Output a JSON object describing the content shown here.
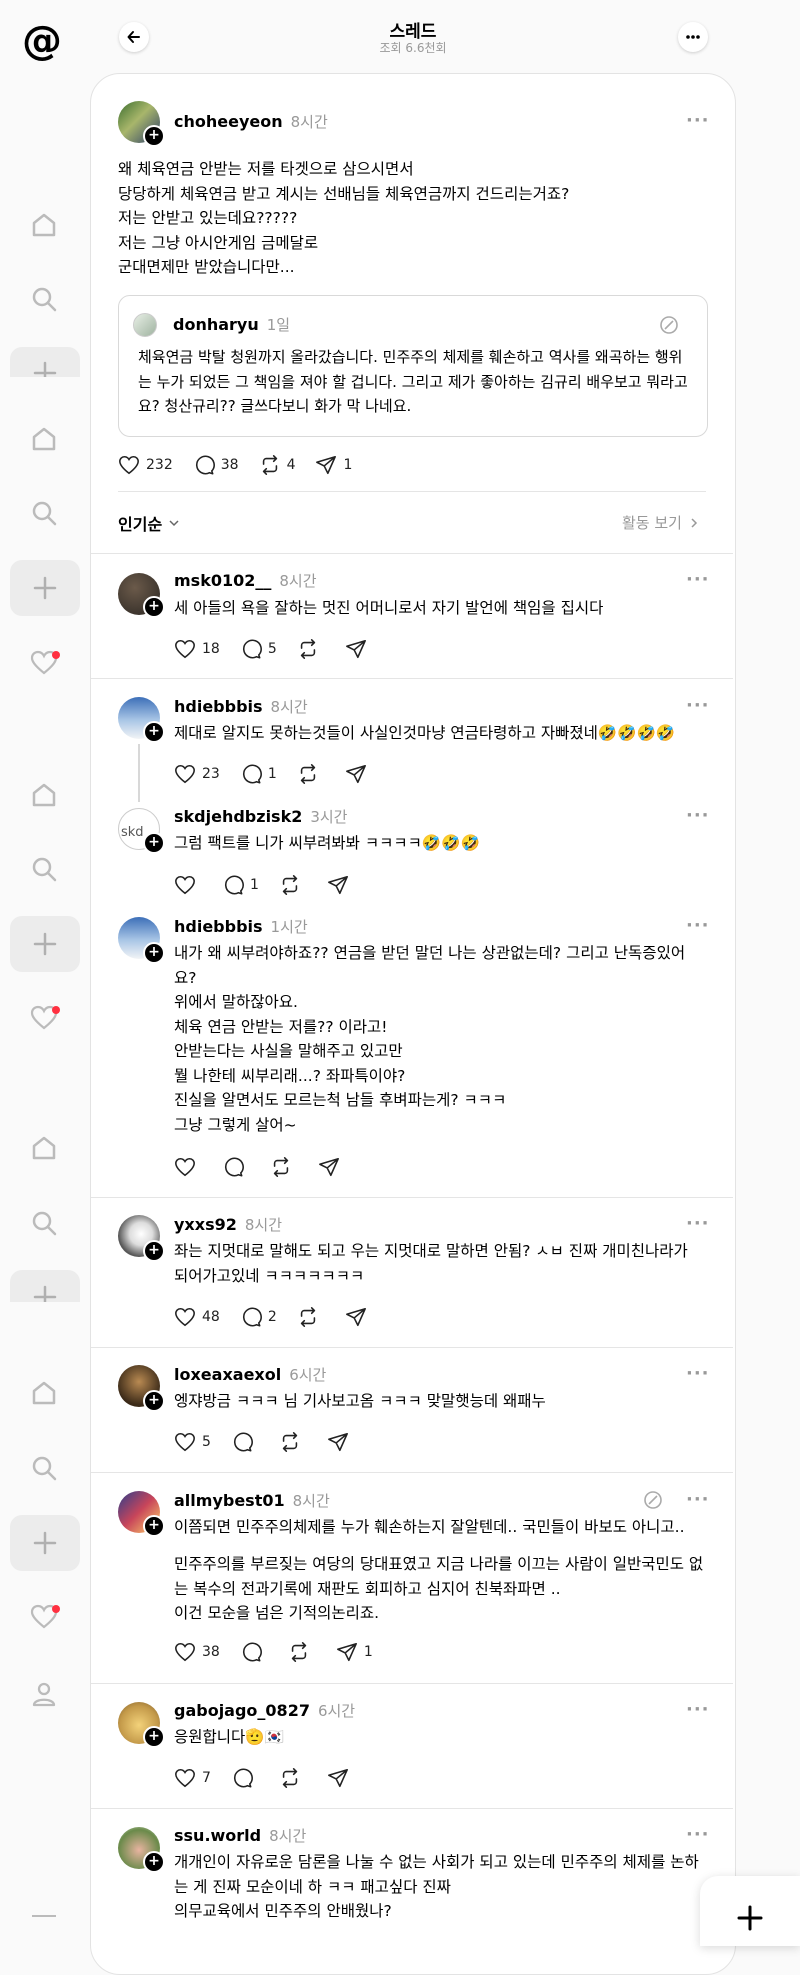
{
  "header": {
    "title": "스레드",
    "subtitle": "조회 6.6천회"
  },
  "post": {
    "username": "choheeyeon",
    "time": "8시간",
    "text": "왜 체육연금 안받는 저를 타겟으로 삼으시면서\n당당하게 체육연금 받고 계시는 선배님들 체육연금까지 건드리는거죠?\n저는 안받고 있는데요?????\n저는 그냥 아시안게임 금메달로\n군대면제만 받았습니다만...",
    "quote": {
      "username": "donharyu",
      "time": "1일",
      "text": "체육연금 박탈 청원까지 올라갔습니다. 민주주의 체제를 훼손하고 역사를 왜곡하는 행위는 누가 되었든 그 책임을 져야 할 겁니다. 그리고 제가 좋아하는 김규리 배우보고 뭐라고요? 청산규리?? 글쓰다보니 화가 막 나네요."
    },
    "likes": "232",
    "replies": "38",
    "reposts": "4",
    "shares": "1"
  },
  "sort": {
    "label": "인기순",
    "activity": "활동 보기"
  },
  "comments": [
    {
      "username": "msk0102__",
      "time": "8시간",
      "text": "세 아들의 욕을 잘하는 멋진 어머니로서 자기 발언에 책임을 집시다",
      "likes": "18",
      "replies": "5",
      "shares": ""
    },
    {
      "username": "hdiebbbis",
      "time": "8시간",
      "text": "제대로 알지도 못하는것들이 사실인것마냥 연금타령하고 자빠졌네🤣🤣🤣🤣",
      "likes": "23",
      "replies": "1",
      "shares": ""
    },
    {
      "username": "skdjehdbzisk2",
      "time": "3시간",
      "text": "그럼 팩트를 니가 씨부려봐봐 ㅋㅋㅋㅋ🤣🤣🤣",
      "likes": "",
      "replies": "1",
      "shares": "",
      "avatar_alt": "skd"
    },
    {
      "username": "hdiebbbis",
      "time": "1시간",
      "text": "내가 왜 씨부려야하죠?? 연금을 받던 말던 나는 상관없는데? 그리고 난독증있어요?\n위에서 말하잖아요.\n체육 연금 안받는 저를?? 이라고!\n안받는다는 사실을 말해주고 있고만\n뭘 나한테 씨부리래...? 좌파특이야?\n진실을 알면서도 모르는척 남들 후벼파는게? ㅋㅋㅋ\n그냥 그렇게 살어~",
      "likes": "",
      "replies": "",
      "shares": ""
    },
    {
      "username": "yxxs92",
      "time": "8시간",
      "text": "좌는 지멋대로 말해도 되고 우는 지멋대로 말하면 안됨? ㅅㅂ 진짜 개미친나라가 되어가고있네 ㅋㅋㅋㅋㅋㅋㅋ",
      "likes": "48",
      "replies": "2",
      "shares": ""
    },
    {
      "username": "loxeaxaexol",
      "time": "6시간",
      "text": "엥쟈방금 ㅋㅋㅋ 님 기사보고옴 ㅋㅋㅋ 맞말햇능데 왜패누",
      "likes": "5",
      "replies": "",
      "shares": ""
    },
    {
      "username": "allmybest01",
      "time": "8시간",
      "text": "이쯤되면 민주주의체제를 누가 훼손하는지 잘알텐데.. 국민들이 바보도 아니고..",
      "text2": "민주주의를 부르짖는 여당의 당대표였고 지금 나라를 이끄는 사람이 일반국민도 없는 복수의 전과기록에 재판도 회피하고 심지어 친북좌파면 ..\n이건 모순을 넘은 기적의논리죠.",
      "likes": "38",
      "replies": "",
      "shares": "1"
    },
    {
      "username": "gabojago_0827",
      "time": "6시간",
      "text": "응원합니다🫡🇰🇷",
      "likes": "7",
      "replies": "",
      "shares": ""
    },
    {
      "username": "ssu.world",
      "time": "8시간",
      "text": "개개인이 자유로운 담론을 나눌 수 없는 사회가 되고 있는데 민주주의 체제를 논하는 게 진짜 모순이네 하 ㅋㅋ 패고싶다 진짜\n의무교육에서 민주주의 안배웠나?"
    }
  ]
}
